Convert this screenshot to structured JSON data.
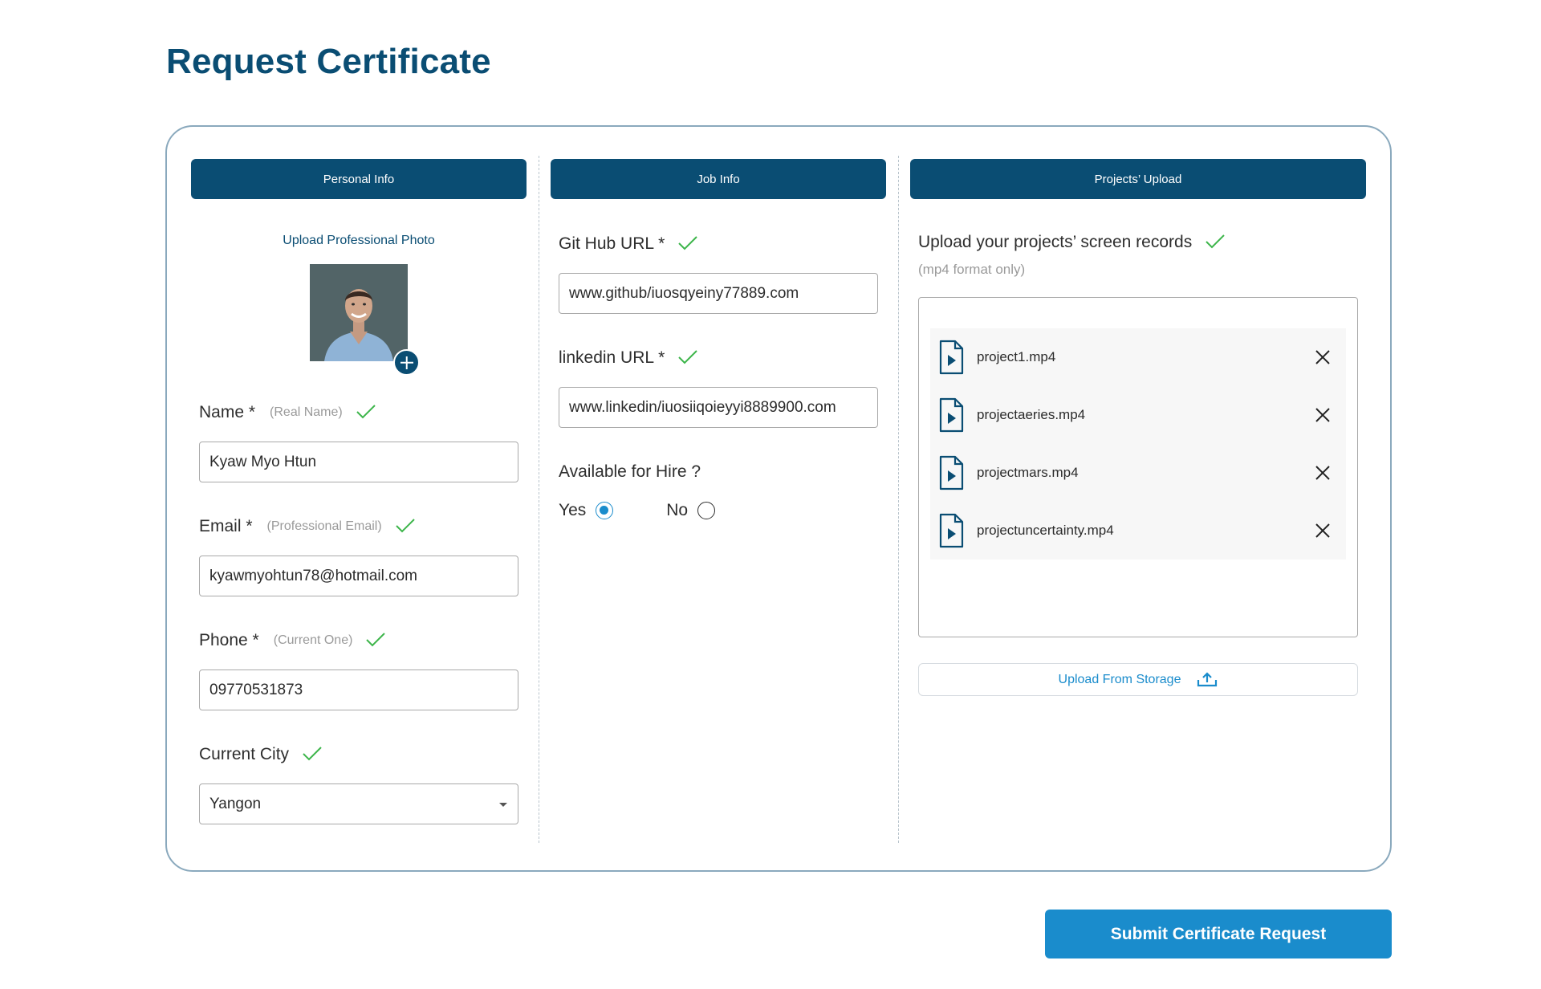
{
  "page": {
    "title": "Request Certificate"
  },
  "tabs": {
    "personal": "Personal Info",
    "job": "Job Info",
    "projects": "Projects’ Upload"
  },
  "personal": {
    "upload_photo_label": "Upload Professional Photo",
    "name": {
      "label": "Name *",
      "hint": "(Real Name)",
      "value": "Kyaw Myo Htun"
    },
    "email": {
      "label": "Email *",
      "hint": "(Professional Email)",
      "value": "kyawmyohtun78@hotmail.com"
    },
    "phone": {
      "label": "Phone *",
      "hint": "(Current One)",
      "value": "09770531873"
    },
    "city": {
      "label": "Current City",
      "value": "Yangon"
    }
  },
  "job": {
    "github": {
      "label": "Git Hub URL *",
      "value": "www.github/iuosqyeiny77889.com"
    },
    "linkedin": {
      "label": "linkedin URL *",
      "value": "www.linkedin/iuosiiqoieyyi8889900.com"
    },
    "hire": {
      "label": "Available for Hire ?",
      "yes": "Yes",
      "no": "No",
      "selected": "Yes"
    }
  },
  "projects": {
    "title": "Upload your projects’ screen records",
    "hint": "(mp4 format only)",
    "files": [
      {
        "name": "project1.mp4"
      },
      {
        "name": "projectaeries.mp4"
      },
      {
        "name": "projectmars.mp4"
      },
      {
        "name": "projectuncertainty.mp4"
      }
    ],
    "upload_button": "Upload From Storage"
  },
  "actions": {
    "submit": "Submit Certificate Request"
  },
  "colors": {
    "primary": "#0a4d73",
    "accent": "#1a8ccc",
    "check": "#3cb54a"
  },
  "icons": {
    "check": "check-icon",
    "add_photo": "plus-circle-icon",
    "file": "video-file-icon",
    "remove": "close-icon",
    "upload": "upload-icon",
    "caret": "caret-down-icon"
  }
}
